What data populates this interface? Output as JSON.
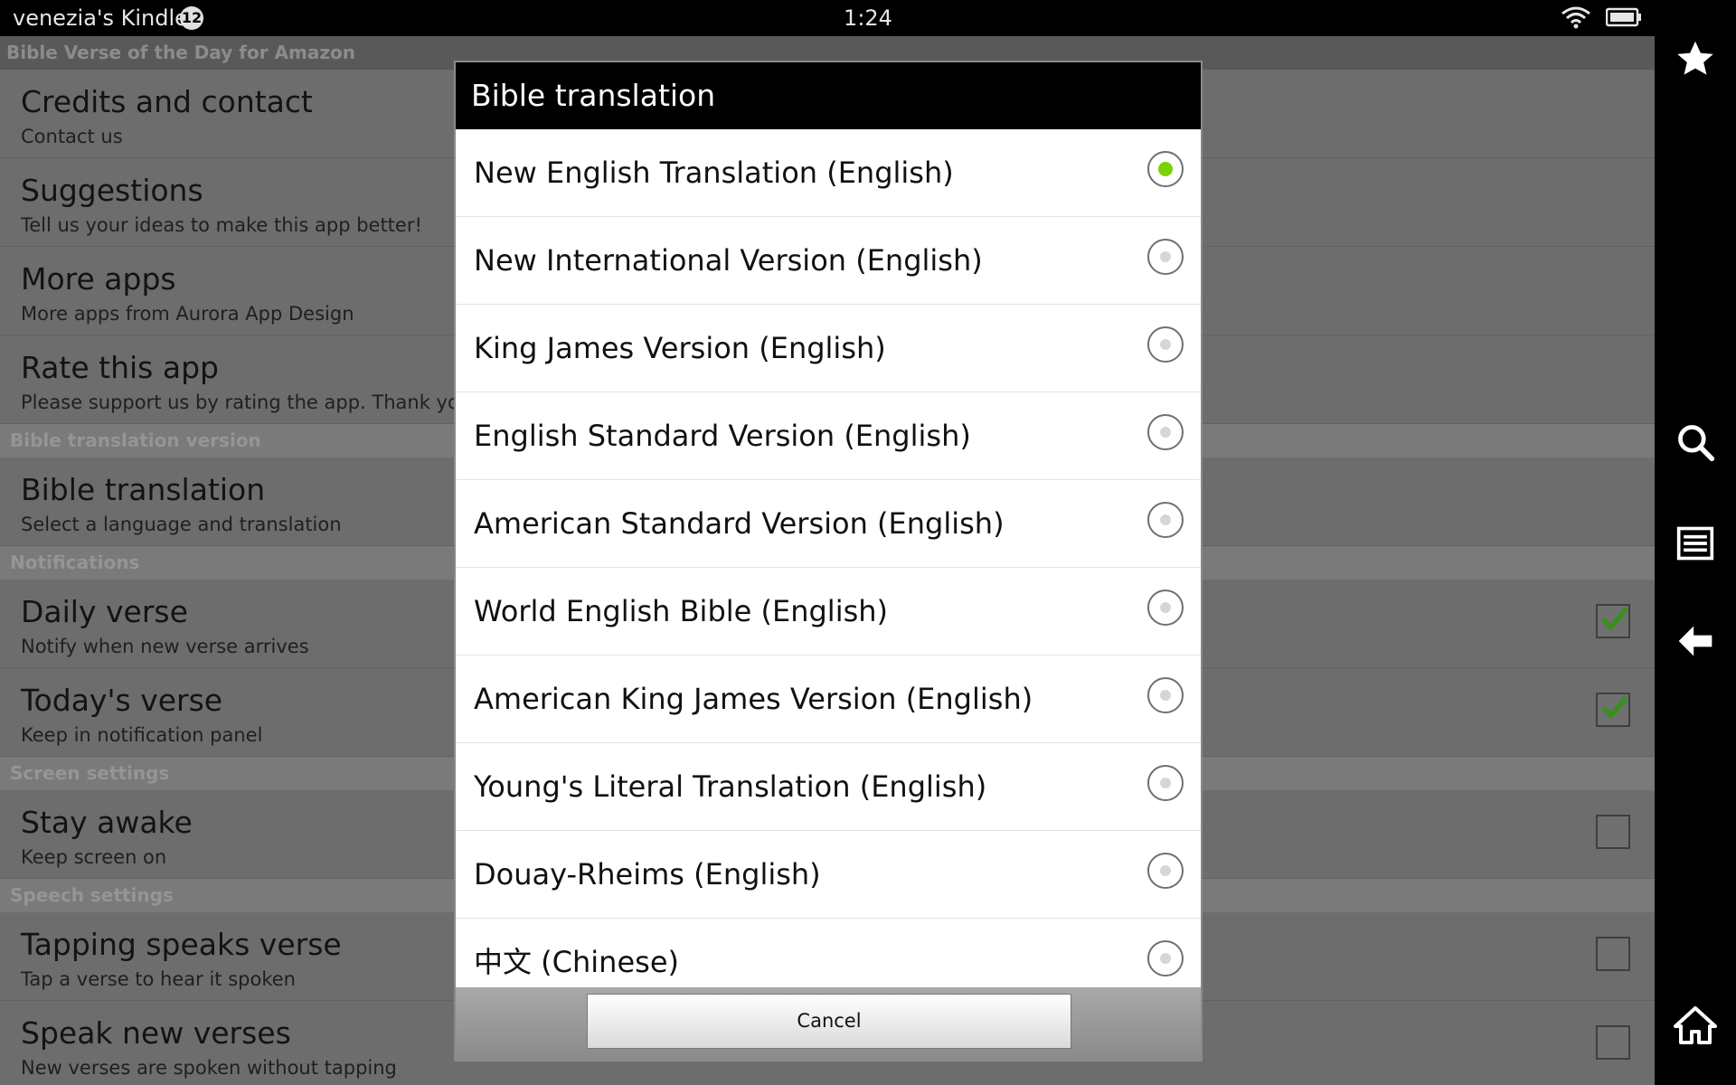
{
  "status_bar": {
    "device_name": "venezia's Kindle",
    "notification_count": "12",
    "time": "1:24"
  },
  "nav": {
    "icons": [
      "star-icon",
      "search-icon",
      "menu-icon",
      "back-arrow-icon",
      "home-icon"
    ]
  },
  "app": {
    "title": "Bible Verse of the Day for Amazon"
  },
  "settings": {
    "credits": {
      "title": "Credits and contact",
      "summary": "Contact us"
    },
    "suggestions": {
      "title": "Suggestions",
      "summary": "Tell us your ideas to make this app better!"
    },
    "more_apps": {
      "title": "More apps",
      "summary": "More apps from Aurora App Design"
    },
    "rate": {
      "title": "Rate this app",
      "summary": "Please support us by rating the app. Thank you!"
    },
    "section_translation": "Bible translation version",
    "translation": {
      "title": "Bible translation",
      "summary": "Select a language and translation"
    },
    "section_notifications": "Notifications",
    "daily_verse": {
      "title": "Daily verse",
      "summary": "Notify when new verse arrives",
      "checked": true
    },
    "todays_verse": {
      "title": "Today's verse",
      "summary": "Keep in notification panel",
      "checked": true
    },
    "section_screen": "Screen settings",
    "stay_awake": {
      "title": "Stay awake",
      "summary": "Keep screen on",
      "checked": false
    },
    "section_speech": "Speech settings",
    "tapping_speaks": {
      "title": "Tapping speaks verse",
      "summary": "Tap a verse to hear it spoken",
      "checked": false
    },
    "speak_new": {
      "title": "Speak new verses",
      "summary": "New verses are spoken without tapping",
      "checked": false
    }
  },
  "dialog": {
    "title": "Bible translation",
    "selected_index": 0,
    "options": [
      "New English Translation (English)",
      "New International Version (English)",
      "King James Version (English)",
      "English Standard Version (English)",
      "American Standard Version (English)",
      "World English Bible (English)",
      "American King James Version (English)",
      "Young's Literal Translation (English)",
      "Douay-Rheims (English)",
      "中文 (Chinese)"
    ],
    "cancel_label": "Cancel"
  },
  "colors": {
    "accent_radio": "#7cd100",
    "check_mark": "#3a8f1f",
    "dim_overlay_bg": "#6d6d6d"
  }
}
